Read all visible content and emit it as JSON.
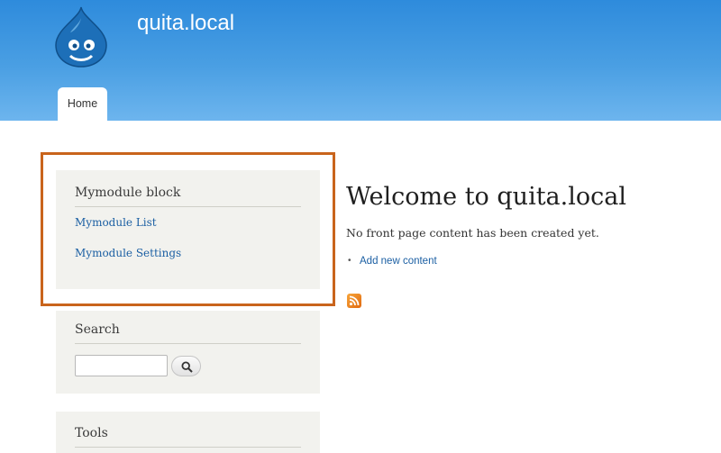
{
  "header": {
    "site_name": "quita.local",
    "logo_icon": "drupal-drop-icon",
    "nav": [
      {
        "label": "Home"
      }
    ]
  },
  "sidebar": {
    "mymodule_block": {
      "title": "Mymodule block",
      "links": [
        {
          "label": "Mymodule List"
        },
        {
          "label": "Mymodule Settings"
        }
      ]
    },
    "search_block": {
      "title": "Search",
      "input_value": "",
      "button_icon": "search-icon"
    },
    "tools_block": {
      "title": "Tools"
    }
  },
  "main": {
    "title": "Welcome to quita.local",
    "message": "No front page content has been created yet.",
    "action_links": [
      {
        "label": "Add new content"
      }
    ],
    "feed_icon": "rss-icon"
  },
  "colors": {
    "header_blue": "#2e8bdc",
    "highlight_orange": "#c9641c",
    "link_blue": "#1b5fa3",
    "block_bg": "#f2f2ee"
  }
}
